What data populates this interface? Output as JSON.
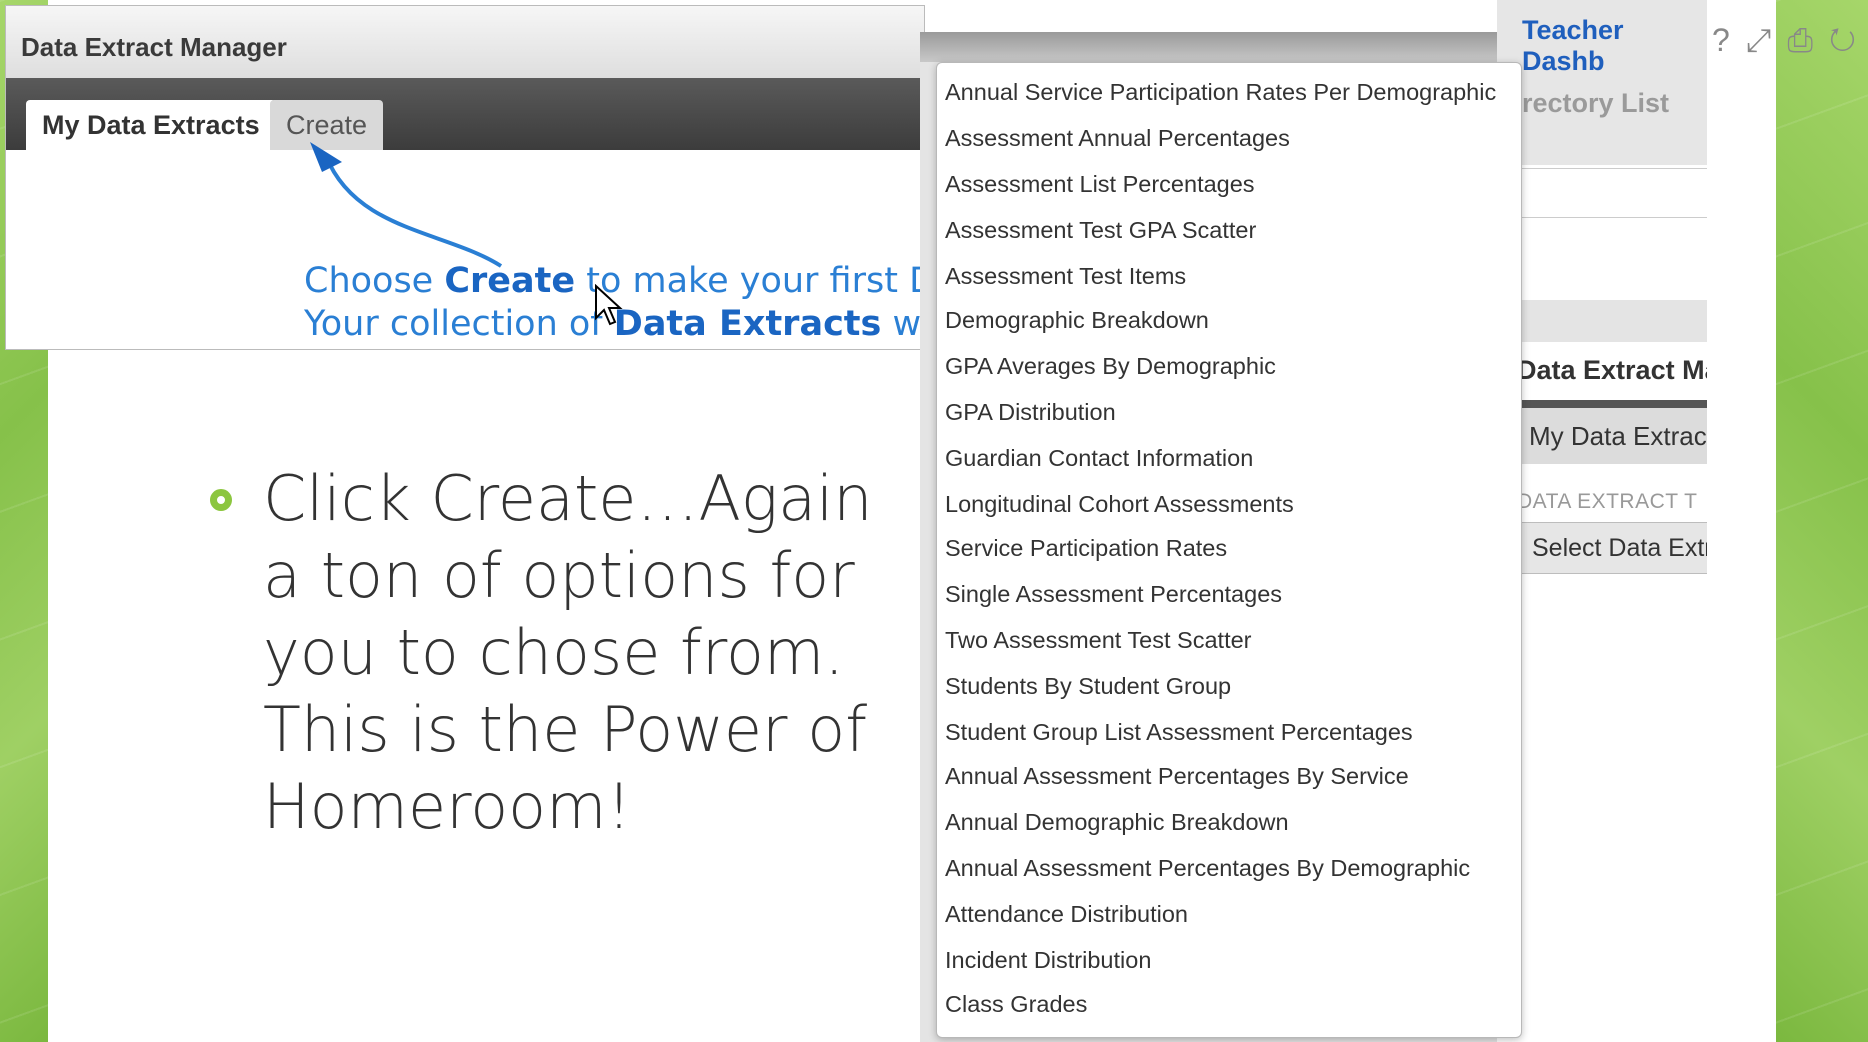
{
  "window": {
    "title": "Data Extract Manager",
    "tabs": [
      {
        "label": "My Data Extracts"
      },
      {
        "label": "Create"
      }
    ],
    "instruction": {
      "line1_a": "Choose ",
      "line1_b": "Create",
      "line1_c": " to make your first Da",
      "line2_a": "Your collection of ",
      "line2_b": "Data Extracts",
      "line2_c": " will a"
    }
  },
  "right_window": {
    "top_title": "Teacher Dashb",
    "directory_link": "rectory List",
    "section_title": "Data Extract Ma",
    "tab_label": "My Data Extrac",
    "field_label": "DATA EXTRACT T",
    "select_label": "Select Data Extr",
    "icons": [
      "help-icon",
      "expand-icon",
      "print-icon",
      "refresh-icon"
    ]
  },
  "dropdown": {
    "items": [
      "Annual Service Participation Rates Per Demographic",
      "Assessment Annual Percentages",
      "Assessment List Percentages",
      "Assessment Test GPA Scatter",
      "Assessment Test Items",
      "Demographic Breakdown",
      "GPA Averages By Demographic",
      "GPA Distribution",
      "Guardian Contact Information",
      "Longitudinal Cohort Assessments",
      "Service Participation Rates",
      "Single Assessment Percentages",
      "Two Assessment Test Scatter",
      "Students By Student Group",
      "Student Group List Assessment Percentages",
      "Annual Assessment Percentages By Service",
      "Annual Demographic Breakdown",
      "Annual Assessment Percentages By Demographic",
      "Attendance Distribution",
      "Incident Distribution",
      "Class Grades"
    ]
  },
  "slide": {
    "bullet_lines": [
      "Click Create…Again",
      "a ton of options for",
      "you to chose from.",
      "This is the Power of",
      "Homeroom!"
    ]
  },
  "colors": {
    "accent_green": "#8cc63f",
    "link_blue": "#2a7fd4"
  }
}
